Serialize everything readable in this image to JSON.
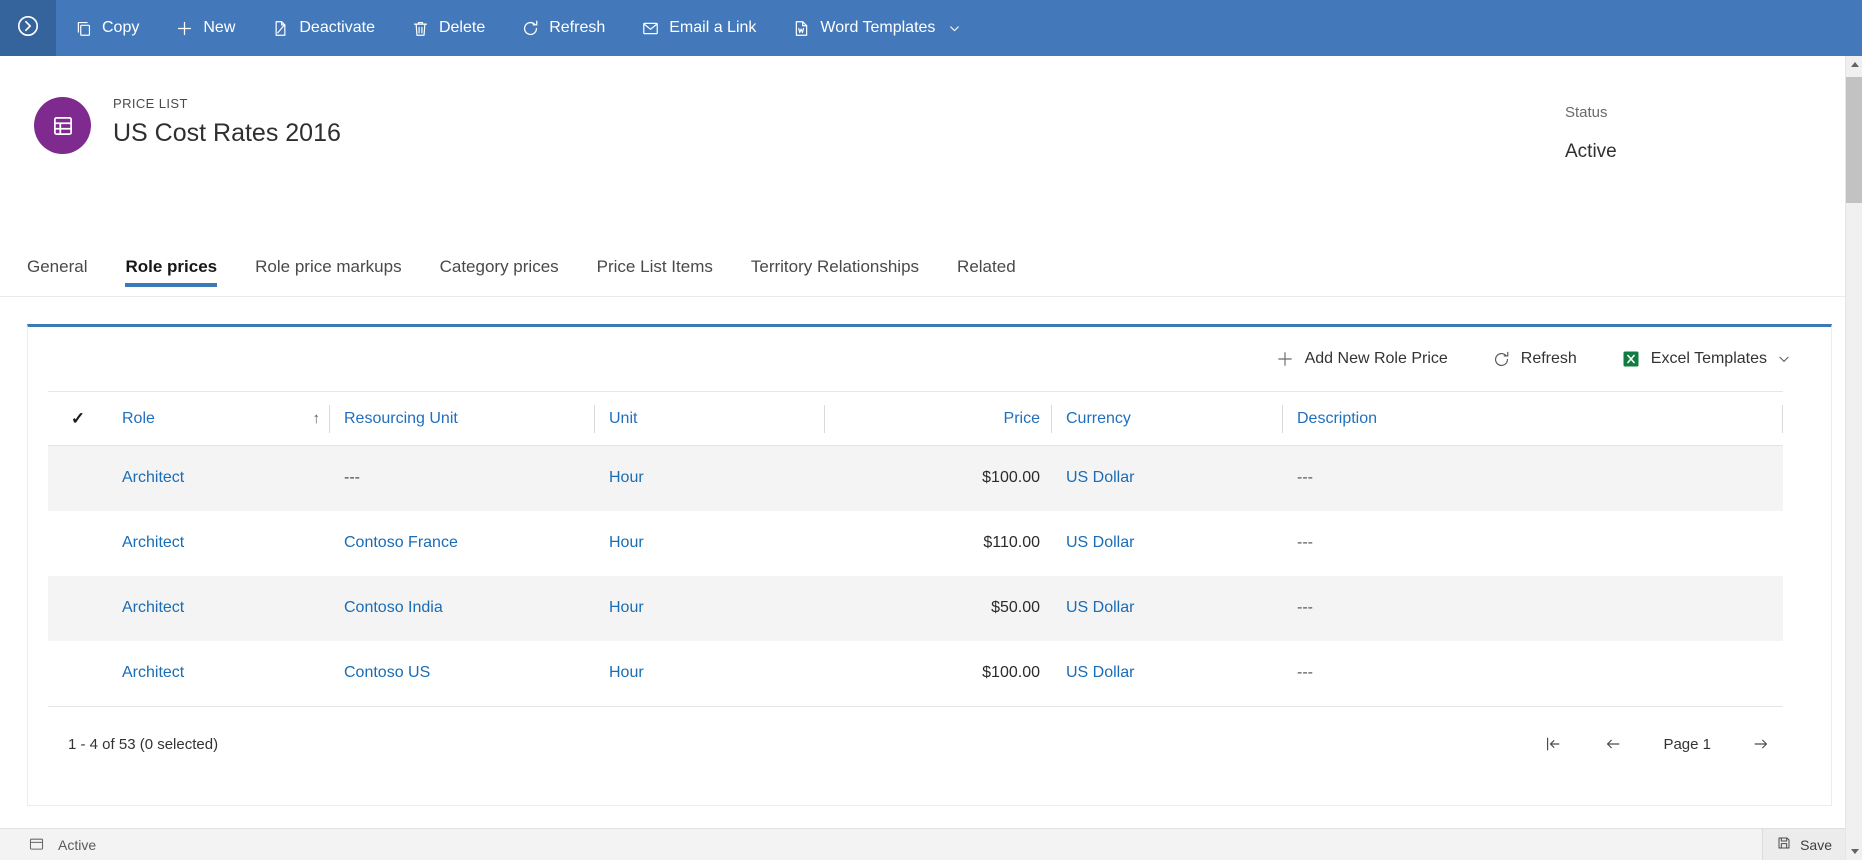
{
  "command_bar": {
    "items": [
      {
        "label": "Copy"
      },
      {
        "label": "New"
      },
      {
        "label": "Deactivate"
      },
      {
        "label": "Delete"
      },
      {
        "label": "Refresh"
      },
      {
        "label": "Email a Link"
      },
      {
        "label": "Word Templates"
      }
    ]
  },
  "header": {
    "entity_label": "PRICE LIST",
    "title": "US Cost Rates 2016",
    "status_label": "Status",
    "status_value": "Active"
  },
  "tabs": [
    "General",
    "Role prices",
    "Role price markups",
    "Category prices",
    "Price List Items",
    "Territory Relationships",
    "Related"
  ],
  "active_tab": "Role prices",
  "grid": {
    "toolbar": {
      "add_label": "Add New Role Price",
      "refresh_label": "Refresh",
      "excel_label": "Excel Templates"
    },
    "columns": [
      "Role",
      "Resourcing Unit",
      "Unit",
      "Price",
      "Currency",
      "Description"
    ],
    "rows": [
      {
        "role": "Architect",
        "resourcing_unit": "---",
        "unit": "Hour",
        "price": "$100.00",
        "currency": "US Dollar",
        "description": "---"
      },
      {
        "role": "Architect",
        "resourcing_unit": "Contoso France",
        "unit": "Hour",
        "price": "$110.00",
        "currency": "US Dollar",
        "description": "---"
      },
      {
        "role": "Architect",
        "resourcing_unit": "Contoso India",
        "unit": "Hour",
        "price": "$50.00",
        "currency": "US Dollar",
        "description": "---"
      },
      {
        "role": "Architect",
        "resourcing_unit": "Contoso US",
        "unit": "Hour",
        "price": "$100.00",
        "currency": "US Dollar",
        "description": "---"
      }
    ],
    "footer": {
      "record_count": "1 - 4 of 53 (0 selected)",
      "page_label": "Page 1"
    }
  },
  "status_bar": {
    "state": "Active",
    "save_label": "Save"
  },
  "icons": {
    "check": "✓",
    "sort_ascending": "↑"
  },
  "colors": {
    "command_bar": "#4379bb",
    "command_bar_dark": "#35649c",
    "accent_blue": "#3b79b7",
    "link": "#1a6cb5",
    "entity_icon_purple": "#7f2a8e",
    "excel_green": "#107c41"
  }
}
